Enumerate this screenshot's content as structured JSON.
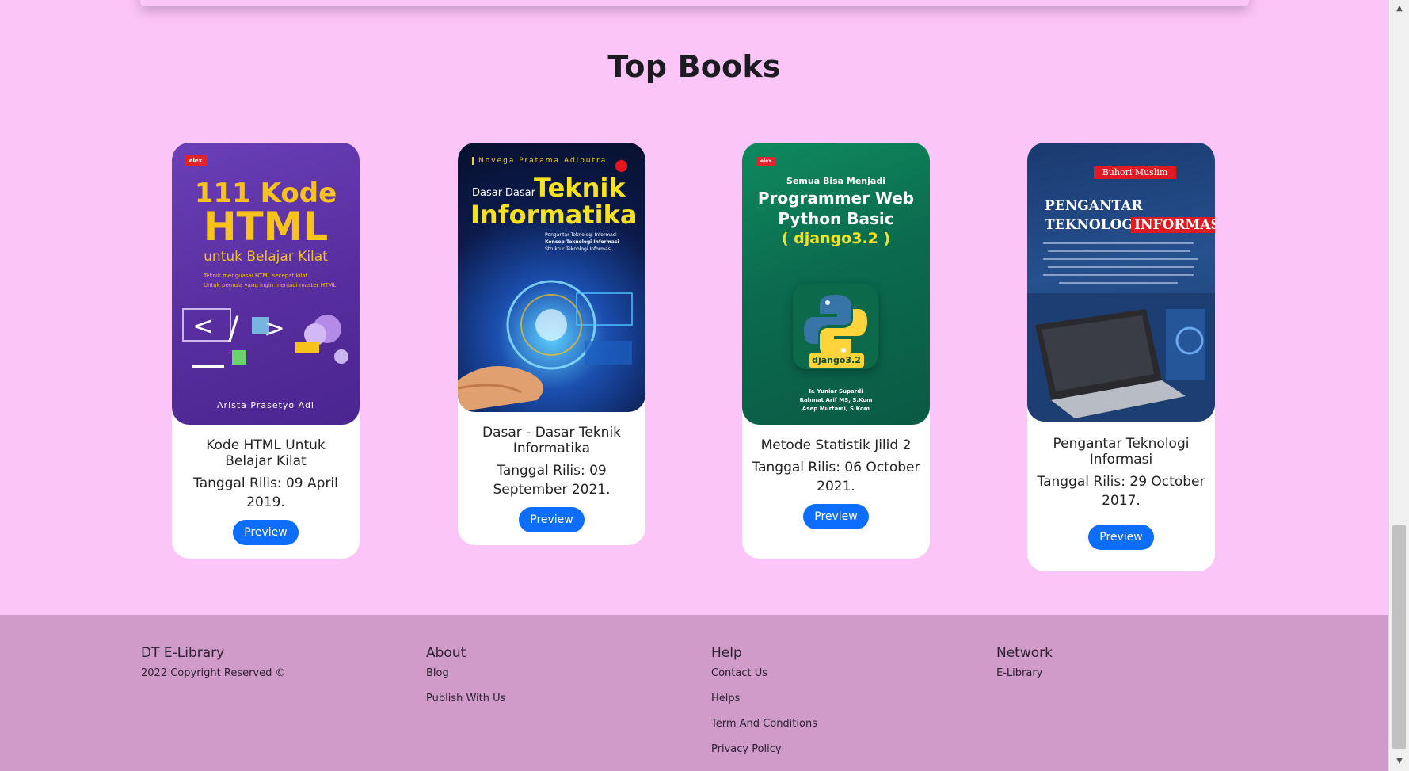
{
  "section": {
    "title": "Top Books"
  },
  "books": [
    {
      "title": "Kode HTML Untuk Belajar Kilat",
      "date": "Tanggal Rilis: 09 April 2019.",
      "button": "Preview",
      "cover": {
        "publisher": "elex",
        "line1": "111 Kode",
        "line2": "HTML",
        "line3": "untuk Belajar Kilat",
        "bullet1": "Teknik menguasai HTML secepat kilat",
        "bullet2": "Untuk pemula yang ingin menjadi master HTML",
        "author": "Arista Prasetyo Adi"
      }
    },
    {
      "title": "Dasar - Dasar Teknik Informatika",
      "date": "Tanggal Rilis: 09 September 2021.",
      "button": "Preview",
      "cover": {
        "author": "Novega Pratama Adiputra",
        "line1": "Dasar-Dasar",
        "line2": "Teknik",
        "line3": "Informatika",
        "bullet1": "Pengantar Teknologi Informasi",
        "bullet2": "Konsep Teknologi Informasi",
        "bullet3": "Struktur Teknologi Informasi"
      }
    },
    {
      "title": "Metode Statistik Jilid 2",
      "date": "Tanggal Rilis: 06 October 2021.",
      "button": "Preview",
      "cover": {
        "publisher": "elex",
        "line1": "Semua Bisa Menjadi",
        "line2": "Programmer Web",
        "line3": "Python Basic",
        "line4": "( django3.2 )",
        "badge": "django3.2",
        "authors": [
          "Ir. Yuniar Supardi",
          "Rahmat Arif MS, S.Kom",
          "Asep Murtami, S.Kom"
        ]
      }
    },
    {
      "title": "Pengantar Teknologi Informasi",
      "date": "Tanggal Rilis: 29 October 2017.",
      "button": "Preview",
      "cover": {
        "author": "Buhori Muslim",
        "line1": "PENGANTAR",
        "line2": "TEKNOLOGI",
        "line3": "INFORMASI"
      }
    }
  ],
  "footer": {
    "brand": {
      "title": "DT E-Library",
      "copyright": "2022 Copyright Reserved ©"
    },
    "about": {
      "title": "About",
      "links": [
        "Blog",
        "Publish With Us"
      ]
    },
    "help": {
      "title": "Help",
      "links": [
        "Contact Us",
        "Helps",
        "Term And Conditions",
        "Privacy Policy"
      ]
    },
    "network": {
      "title": "Network",
      "links": [
        "E-Library"
      ]
    }
  },
  "colors": {
    "page_bg": "#fcc5f8",
    "footer_bg": "#d09ac9",
    "button": "#0d6efd"
  },
  "icons": {
    "scroll_up": "triangle-up-icon",
    "scroll_down": "triangle-down-icon"
  }
}
